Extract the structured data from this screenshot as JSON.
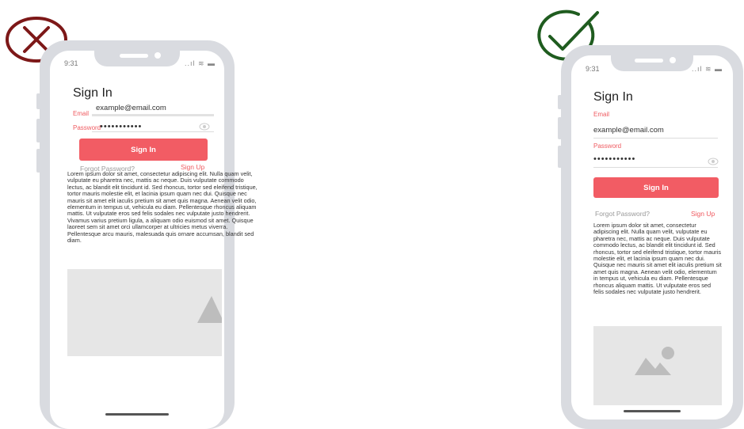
{
  "badges": {
    "bad": {
      "color": "#7d1818",
      "icon": "x-circle-icon"
    },
    "good": {
      "color": "#1f5c1f",
      "icon": "check-circle-icon"
    }
  },
  "colors": {
    "accent": "#f25c64",
    "frame": "#d9dbe0",
    "placeholder": "#e6e6e6"
  },
  "bad_phone": {
    "status": {
      "time": "9:31",
      "icons": "..ıl ≋ ▬"
    },
    "title": "Sign In",
    "email_label": "Email",
    "email_value": "example@email.com",
    "password_label": "Password",
    "password_value": "•••••••••••",
    "signin_button": "Sign In",
    "forgot_link": "Forgot Password?",
    "signup_link": "Sign Up",
    "lorem": "Lorem ipsum dolor sit amet, consectetur adipiscing elit. Nulla quam velit, vulputate eu pharetra nec, mattis ac neque. Duis vulputate commodo lectus, ac blandit elit tincidunt id. Sed rhoncus, tortor sed eleifend tristique, tortor mauris molestie elit, et lacinia ipsum quam nec dui. Quisque nec mauris sit amet elit iaculis pretium sit amet quis magna. Aenean velit odio, elementum in tempus ut, vehicula eu diam. Pellentesque rhoncus aliquam mattis. Ut vulputate eros sed felis sodales nec vulputate justo hendrerit. Vivamus varius pretium ligula, a aliquam odio euismod sit amet. Quisque laoreet sem sit amet orci ullamcorper at ultricies metus viverra. Pellentesque arcu mauris, malesuada quis ornare accumsan, blandit sed diam."
  },
  "good_phone": {
    "status": {
      "time": "9:31",
      "icons": "..ıl ≋ ▬"
    },
    "title": "Sign In",
    "email_label": "Email",
    "email_value": "example@email.com",
    "password_label": "Password",
    "password_value": "•••••••••••",
    "signin_button": "Sign In",
    "forgot_link": "Forgot Password?",
    "signup_link": "Sign Up",
    "lorem": "Lorem ipsum dolor sit amet, consectetur adipiscing elit. Nulla quam velit, vulputate eu pharetra nec, mattis ac neque. Duis vulputate commodo lectus, ac blandit elit tincidunt id. Sed rhoncus, tortor sed eleifend tristique, tortor mauris molestie elit, et lacinia ipsum quam nec dui. Quisque nec mauris sit amet elit iaculis pretium sit amet quis magna. Aenean velit odio, elementum in tempus ut, vehicula eu diam. Pellentesque rhoncus aliquam mattis. Ut vulputate eros sed felis sodales nec vulputate justo hendrerit."
  }
}
